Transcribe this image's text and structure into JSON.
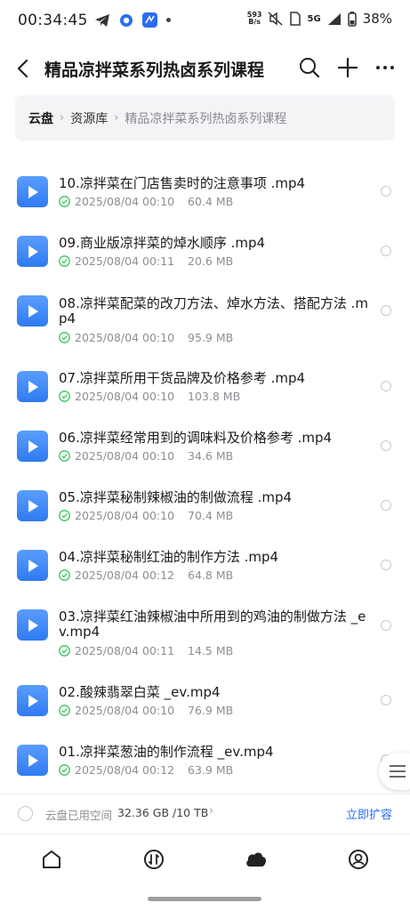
{
  "status_bar": {
    "time": "00:34:45",
    "net_speed_value": "593",
    "net_speed_unit": "B/s",
    "network": "5G",
    "battery": "38%"
  },
  "header": {
    "title": "精品凉拌菜系列热卤系列课程"
  },
  "breadcrumb": {
    "root": "云盘",
    "mid": "资源库",
    "current": "精品凉拌菜系列热卤系列课程"
  },
  "files": [
    {
      "line1": "10.凉拌菜在门店售卖时的注意事项 .mp4",
      "line2": "",
      "date": "2025/08/04 00:10",
      "size": "60.4 MB"
    },
    {
      "line1": "09.商业版凉拌菜的焯水顺序 .mp4",
      "line2": "",
      "date": "2025/08/04 00:11",
      "size": "20.6 MB"
    },
    {
      "line1": "08.凉拌菜配菜的改刀方法、焯水方法、搭配方法 .m",
      "line2": "p4",
      "date": "2025/08/04 00:10",
      "size": "95.9 MB"
    },
    {
      "line1": "07.凉拌菜所用干货品牌及价格参考 .mp4",
      "line2": "",
      "date": "2025/08/04 00:10",
      "size": "103.8 MB"
    },
    {
      "line1": "06.凉拌菜经常用到的调味料及价格参考 .mp4",
      "line2": "",
      "date": "2025/08/04 00:10",
      "size": "34.6 MB"
    },
    {
      "line1": "05.凉拌菜秘制辣椒油的制做流程 .mp4",
      "line2": "",
      "date": "2025/08/04 00:10",
      "size": "70.4 MB"
    },
    {
      "line1": "04.凉拌菜秘制红油的制作方法 .mp4",
      "line2": "",
      "date": "2025/08/04 00:12",
      "size": "64.8 MB"
    },
    {
      "line1": "03.凉拌菜红油辣椒油中所用到的鸡油的制做方法 _e",
      "line2": "v.mp4",
      "date": "2025/08/04 00:11",
      "size": "14.5 MB"
    },
    {
      "line1": "02.酸辣翡翠白菜 _ev.mp4",
      "line2": "",
      "date": "2025/08/04 00:10",
      "size": "76.9 MB"
    },
    {
      "line1": "01.凉拌菜葱油的制作流程 _ev.mp4",
      "line2": "",
      "date": "2025/08/04 00:12",
      "size": "63.9 MB"
    }
  ],
  "storage": {
    "label": "云盘已用空间",
    "value": "32.36 GB /10 TB",
    "action": "立即扩容"
  },
  "icons": {
    "file": "video-file-icon",
    "nav": [
      "home-icon",
      "transfer-icon",
      "cloud-icon",
      "profile-icon"
    ]
  },
  "colors": {
    "accent": "#2a6df4",
    "file_icon": "#3d86f5",
    "success": "#34c759"
  }
}
